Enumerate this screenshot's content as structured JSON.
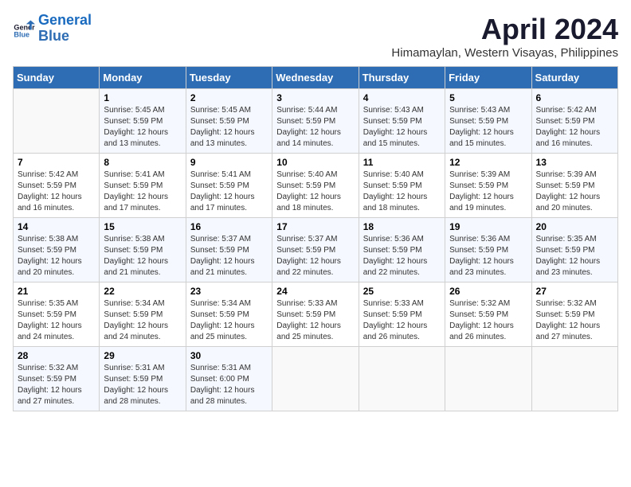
{
  "header": {
    "logo_line1": "General",
    "logo_line2": "Blue",
    "month_title": "April 2024",
    "subtitle": "Himamaylan, Western Visayas, Philippines"
  },
  "weekdays": [
    "Sunday",
    "Monday",
    "Tuesday",
    "Wednesday",
    "Thursday",
    "Friday",
    "Saturday"
  ],
  "weeks": [
    [
      {
        "day": "",
        "info": ""
      },
      {
        "day": "1",
        "info": "Sunrise: 5:45 AM\nSunset: 5:59 PM\nDaylight: 12 hours\nand 13 minutes."
      },
      {
        "day": "2",
        "info": "Sunrise: 5:45 AM\nSunset: 5:59 PM\nDaylight: 12 hours\nand 13 minutes."
      },
      {
        "day": "3",
        "info": "Sunrise: 5:44 AM\nSunset: 5:59 PM\nDaylight: 12 hours\nand 14 minutes."
      },
      {
        "day": "4",
        "info": "Sunrise: 5:43 AM\nSunset: 5:59 PM\nDaylight: 12 hours\nand 15 minutes."
      },
      {
        "day": "5",
        "info": "Sunrise: 5:43 AM\nSunset: 5:59 PM\nDaylight: 12 hours\nand 15 minutes."
      },
      {
        "day": "6",
        "info": "Sunrise: 5:42 AM\nSunset: 5:59 PM\nDaylight: 12 hours\nand 16 minutes."
      }
    ],
    [
      {
        "day": "7",
        "info": "Sunrise: 5:42 AM\nSunset: 5:59 PM\nDaylight: 12 hours\nand 16 minutes."
      },
      {
        "day": "8",
        "info": "Sunrise: 5:41 AM\nSunset: 5:59 PM\nDaylight: 12 hours\nand 17 minutes."
      },
      {
        "day": "9",
        "info": "Sunrise: 5:41 AM\nSunset: 5:59 PM\nDaylight: 12 hours\nand 17 minutes."
      },
      {
        "day": "10",
        "info": "Sunrise: 5:40 AM\nSunset: 5:59 PM\nDaylight: 12 hours\nand 18 minutes."
      },
      {
        "day": "11",
        "info": "Sunrise: 5:40 AM\nSunset: 5:59 PM\nDaylight: 12 hours\nand 18 minutes."
      },
      {
        "day": "12",
        "info": "Sunrise: 5:39 AM\nSunset: 5:59 PM\nDaylight: 12 hours\nand 19 minutes."
      },
      {
        "day": "13",
        "info": "Sunrise: 5:39 AM\nSunset: 5:59 PM\nDaylight: 12 hours\nand 20 minutes."
      }
    ],
    [
      {
        "day": "14",
        "info": "Sunrise: 5:38 AM\nSunset: 5:59 PM\nDaylight: 12 hours\nand 20 minutes."
      },
      {
        "day": "15",
        "info": "Sunrise: 5:38 AM\nSunset: 5:59 PM\nDaylight: 12 hours\nand 21 minutes."
      },
      {
        "day": "16",
        "info": "Sunrise: 5:37 AM\nSunset: 5:59 PM\nDaylight: 12 hours\nand 21 minutes."
      },
      {
        "day": "17",
        "info": "Sunrise: 5:37 AM\nSunset: 5:59 PM\nDaylight: 12 hours\nand 22 minutes."
      },
      {
        "day": "18",
        "info": "Sunrise: 5:36 AM\nSunset: 5:59 PM\nDaylight: 12 hours\nand 22 minutes."
      },
      {
        "day": "19",
        "info": "Sunrise: 5:36 AM\nSunset: 5:59 PM\nDaylight: 12 hours\nand 23 minutes."
      },
      {
        "day": "20",
        "info": "Sunrise: 5:35 AM\nSunset: 5:59 PM\nDaylight: 12 hours\nand 23 minutes."
      }
    ],
    [
      {
        "day": "21",
        "info": "Sunrise: 5:35 AM\nSunset: 5:59 PM\nDaylight: 12 hours\nand 24 minutes."
      },
      {
        "day": "22",
        "info": "Sunrise: 5:34 AM\nSunset: 5:59 PM\nDaylight: 12 hours\nand 24 minutes."
      },
      {
        "day": "23",
        "info": "Sunrise: 5:34 AM\nSunset: 5:59 PM\nDaylight: 12 hours\nand 25 minutes."
      },
      {
        "day": "24",
        "info": "Sunrise: 5:33 AM\nSunset: 5:59 PM\nDaylight: 12 hours\nand 25 minutes."
      },
      {
        "day": "25",
        "info": "Sunrise: 5:33 AM\nSunset: 5:59 PM\nDaylight: 12 hours\nand 26 minutes."
      },
      {
        "day": "26",
        "info": "Sunrise: 5:32 AM\nSunset: 5:59 PM\nDaylight: 12 hours\nand 26 minutes."
      },
      {
        "day": "27",
        "info": "Sunrise: 5:32 AM\nSunset: 5:59 PM\nDaylight: 12 hours\nand 27 minutes."
      }
    ],
    [
      {
        "day": "28",
        "info": "Sunrise: 5:32 AM\nSunset: 5:59 PM\nDaylight: 12 hours\nand 27 minutes."
      },
      {
        "day": "29",
        "info": "Sunrise: 5:31 AM\nSunset: 5:59 PM\nDaylight: 12 hours\nand 28 minutes."
      },
      {
        "day": "30",
        "info": "Sunrise: 5:31 AM\nSunset: 6:00 PM\nDaylight: 12 hours\nand 28 minutes."
      },
      {
        "day": "",
        "info": ""
      },
      {
        "day": "",
        "info": ""
      },
      {
        "day": "",
        "info": ""
      },
      {
        "day": "",
        "info": ""
      }
    ]
  ]
}
